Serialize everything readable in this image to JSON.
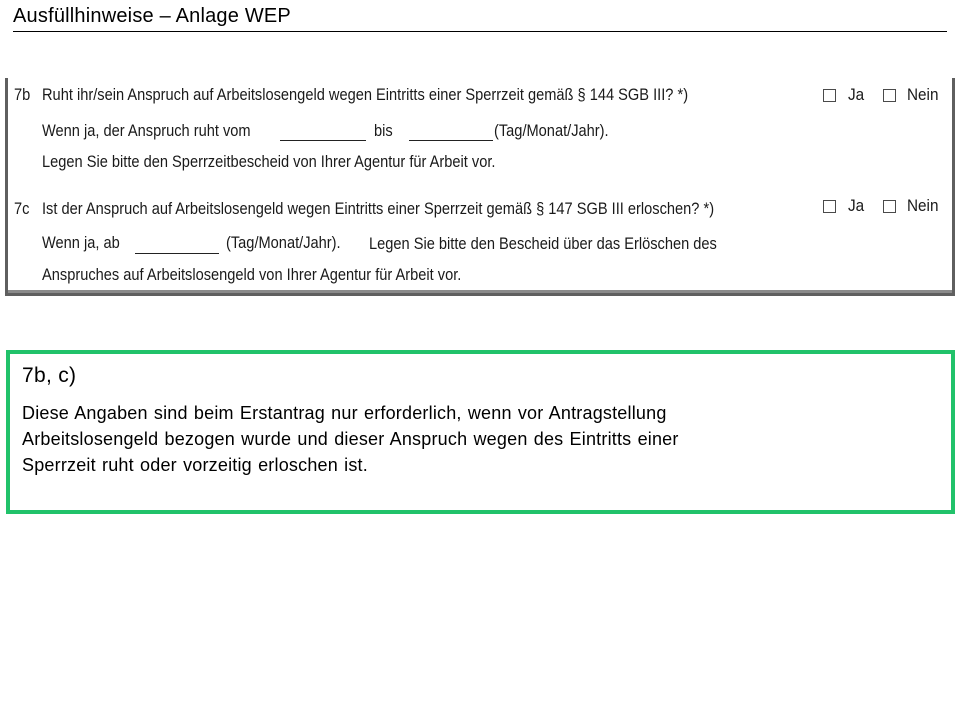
{
  "header": {
    "title": "Ausfüllhinweise – Anlage WEP"
  },
  "form": {
    "q7b": {
      "number": "7b",
      "question": "Ruht ihr/sein Anspruch auf Arbeitslosengeld wegen Eintritts einer Sperrzeit gemäß § 144 SGB III? *)",
      "detail_prefix": "Wenn ja, der Anspruch ruht vom",
      "detail_mid": "bis",
      "detail_suffix": "(Tag/Monat/Jahr).",
      "note": "Legen Sie bitte den Sperrzeitbescheid von Ihrer Agentur für Arbeit vor.",
      "option_yes": "Ja",
      "option_no": "Nein"
    },
    "q7c": {
      "number": "7c",
      "question": "Ist der Anspruch auf Arbeitslosengeld wegen Eintritts einer Sperrzeit gemäß § 147 SGB III erloschen? *)",
      "detail_prefix": "Wenn ja, ab",
      "detail_suffix": "(Tag/Monat/Jahr).",
      "note_part1": "Legen Sie bitte den Bescheid über das Erlöschen des",
      "note_part2": "Anspruches auf Arbeitslosengeld von Ihrer Agentur für Arbeit vor.",
      "option_yes": "Ja",
      "option_no": "Nein"
    }
  },
  "explanation": {
    "heading": "7b, c)",
    "lines": [
      "Diese Angaben sind beim Erstantrag nur erforderlich, wenn vor Antragstellung",
      "Arbeitslosengeld bezogen wurde und dieser Anspruch wegen des Eintritts einer",
      "Sperrzeit ruht oder vorzeitig erloschen ist."
    ],
    "border_color": "#21c26a"
  }
}
